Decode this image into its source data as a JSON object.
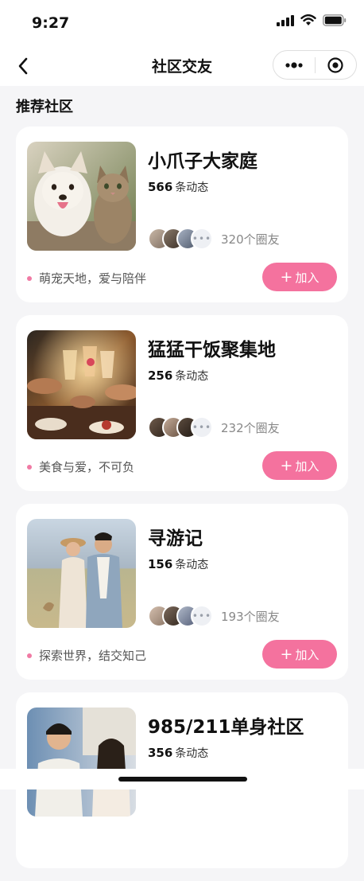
{
  "status_bar": {
    "time": "9:27"
  },
  "nav": {
    "title": "社区交友",
    "back_icon": "chevron-left-icon",
    "more_icon": "more-dots-icon",
    "target_icon": "target-icon"
  },
  "section": {
    "title": "推荐社区"
  },
  "colors": {
    "accent": "#f4729e",
    "tag_dot": "#f07aa4",
    "page_bg": "#f5f5f7"
  },
  "communities": [
    {
      "name": "小爪子大家庭",
      "posts": "566",
      "posts_unit": "条动态",
      "members": "320个圈友",
      "tagline": "萌宠天地，爱与陪伴",
      "join_label": "加入",
      "image": "dog-and-cat-photo"
    },
    {
      "name": "猛猛干饭聚集地",
      "posts": "256",
      "posts_unit": "条动态",
      "members": "232个圈友",
      "tagline": "美食与爱，不可负",
      "join_label": "加入",
      "image": "dinner-toast-photo"
    },
    {
      "name": "寻游记",
      "posts": "156",
      "posts_unit": "条动态",
      "members": "193个圈友",
      "tagline": "探索世界，结交知己",
      "join_label": "加入",
      "image": "travel-couple-photo"
    },
    {
      "name": "985/211单身社区",
      "posts": "356",
      "posts_unit": "条动态",
      "image": "students-photo"
    }
  ]
}
